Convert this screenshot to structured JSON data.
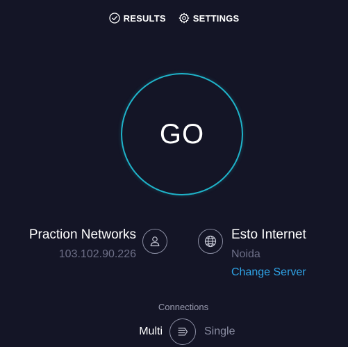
{
  "nav": {
    "results_label": "RESULTS",
    "settings_label": "SETTINGS",
    "results_icon": "check-circle-icon",
    "settings_icon": "gear-icon"
  },
  "go_button": {
    "label": "GO",
    "ring_color": "#1fb3c9"
  },
  "provider": {
    "name": "Praction Networks",
    "ip": "103.102.90.226",
    "icon": "user-icon"
  },
  "server": {
    "name": "Esto Internet",
    "city": "Noida",
    "change_label": "Change Server",
    "icon": "globe-icon",
    "link_color": "#2fa4e7"
  },
  "connections": {
    "title": "Connections",
    "multi_label": "Multi",
    "single_label": "Single",
    "selected": "Multi",
    "icon": "connections-toggle-icon"
  },
  "theme": {
    "background": "#141526",
    "muted_text": "#6e7088"
  }
}
